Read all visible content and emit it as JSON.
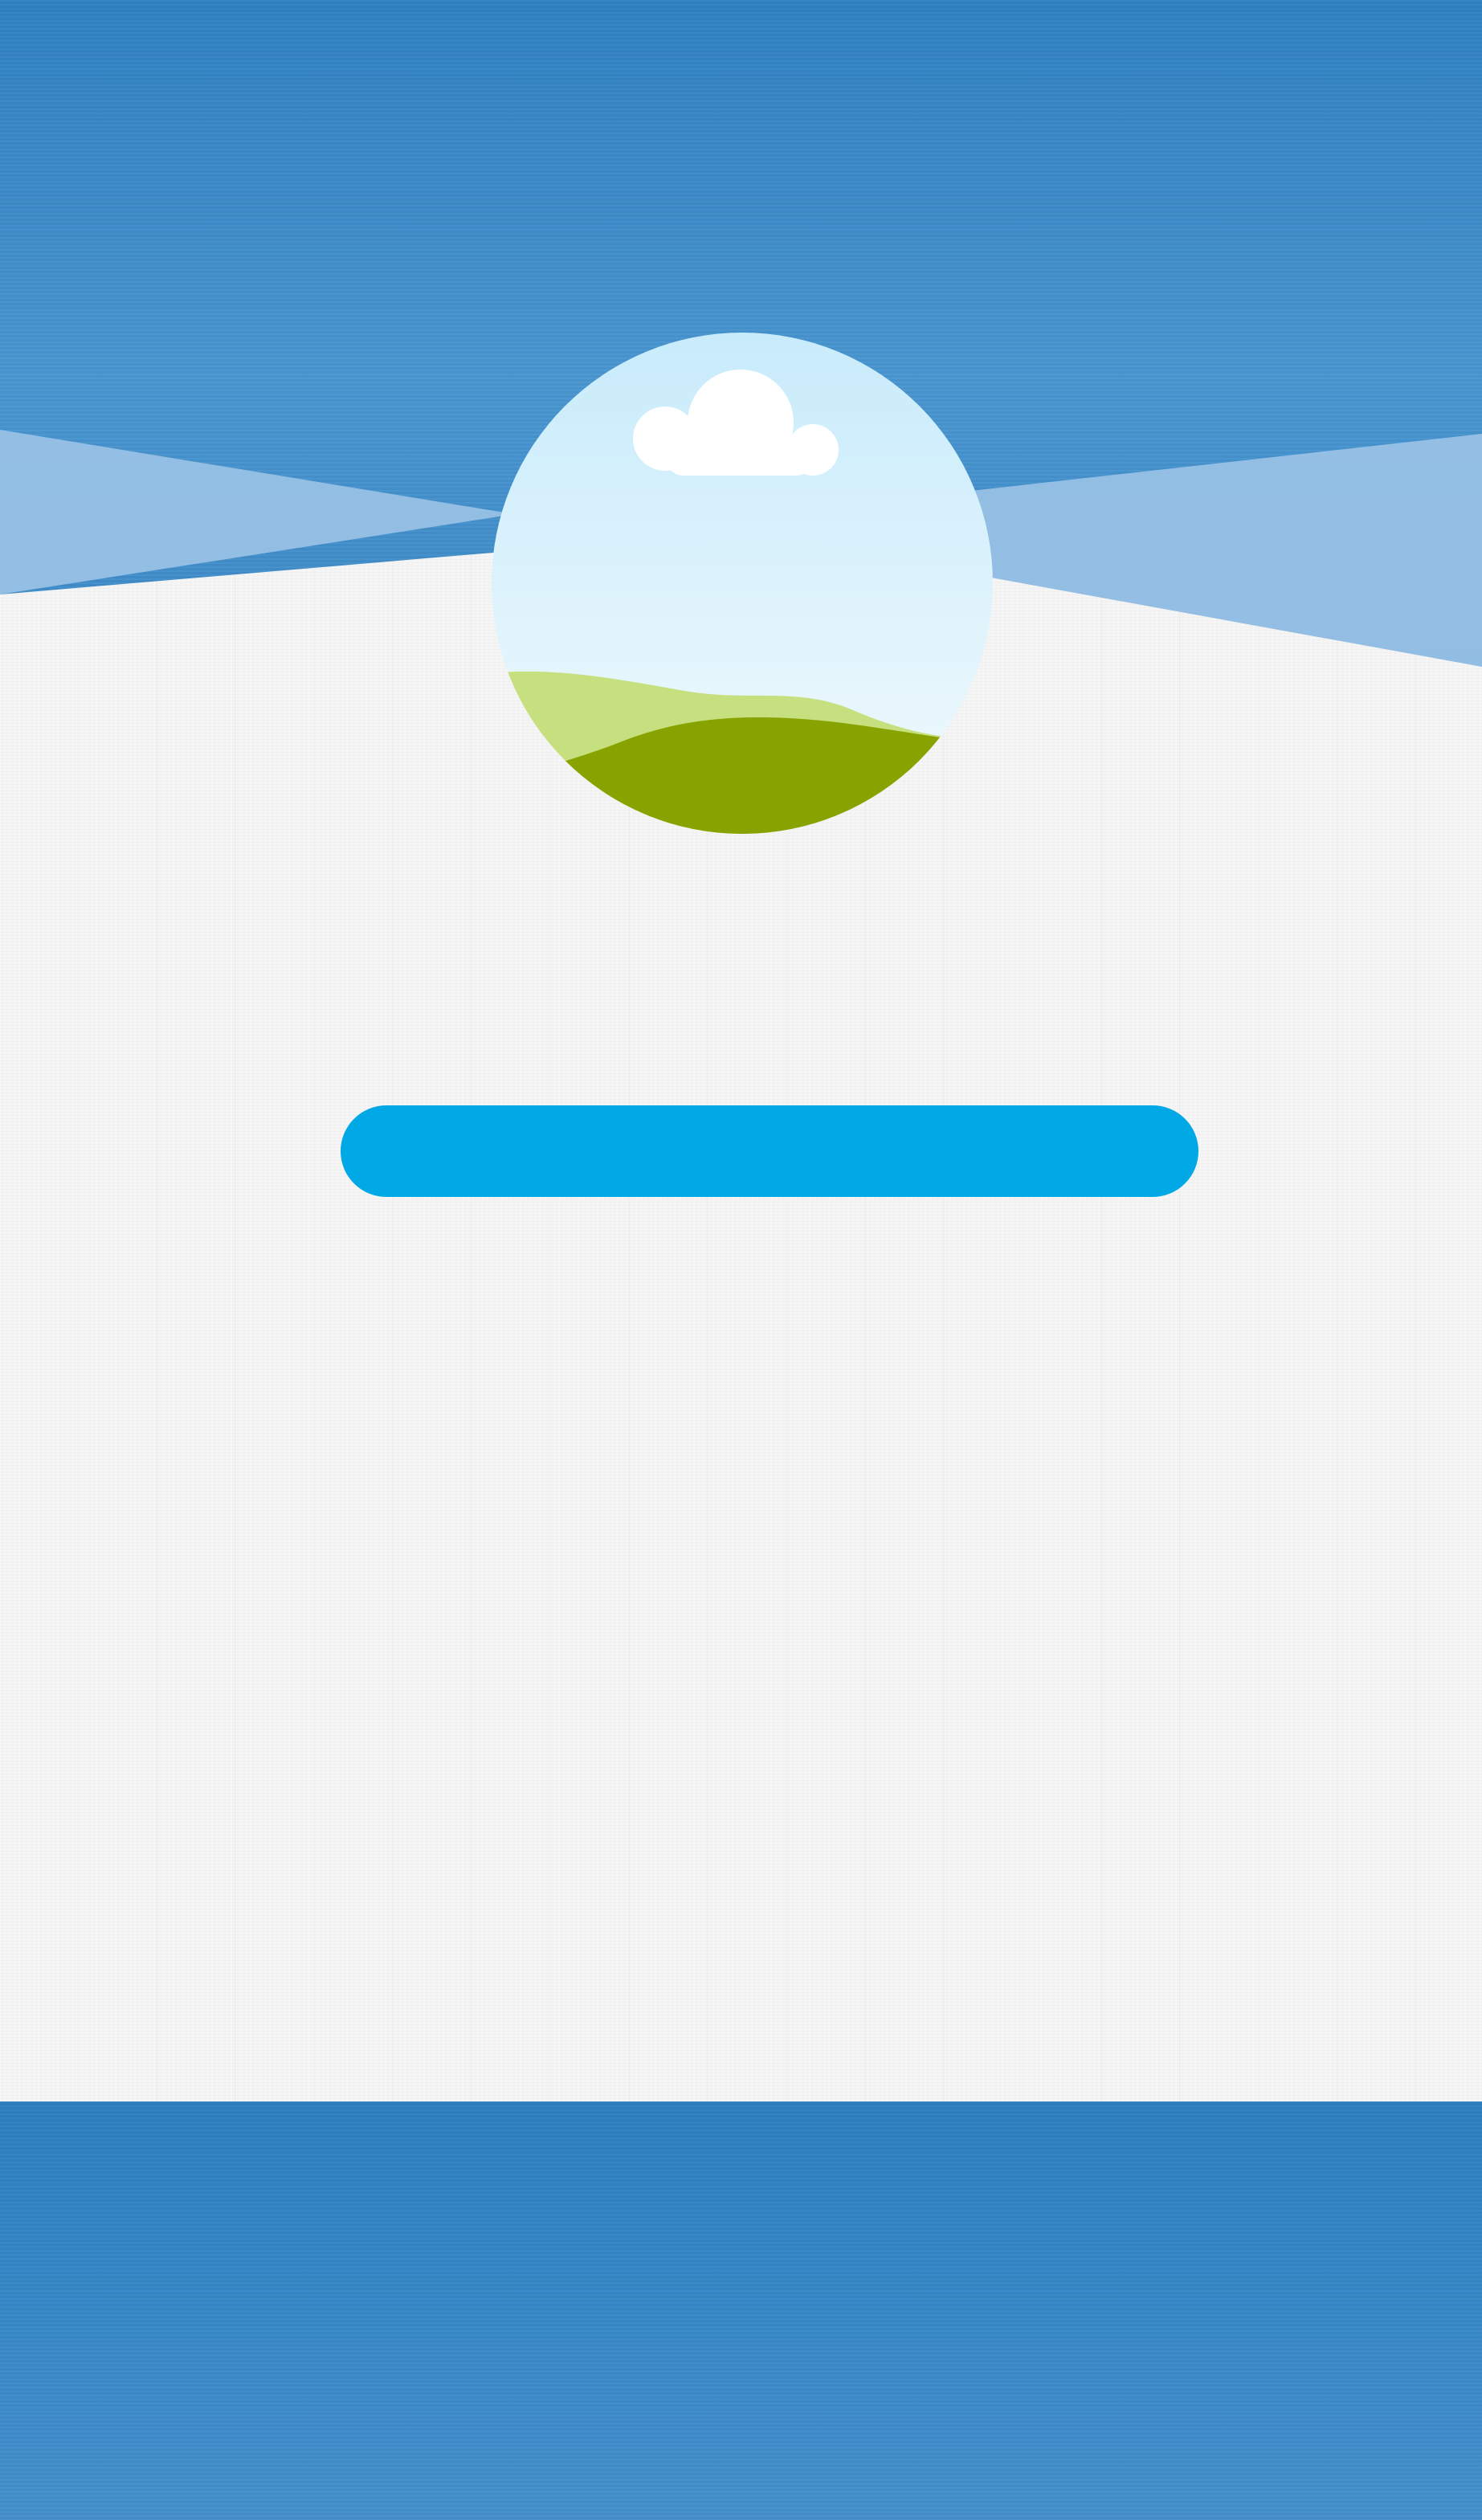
{
  "screen": {
    "name": "welcome-screen"
  },
  "illustration": {
    "icon": "landscape-cloud-icon",
    "colors": {
      "sky_top": "#c9ecfb",
      "sky_bottom": "#eef9fd",
      "cloud": "#ffffff",
      "hill_light": "#c6e07f",
      "hill_dark": "#88a300"
    }
  },
  "primary_button": {
    "label": "",
    "color": "#00a8e6"
  },
  "theme": {
    "band_color": "#3a88c8",
    "wedge_color": "#9dc4e6",
    "paper_color": "#f4f4f4"
  }
}
